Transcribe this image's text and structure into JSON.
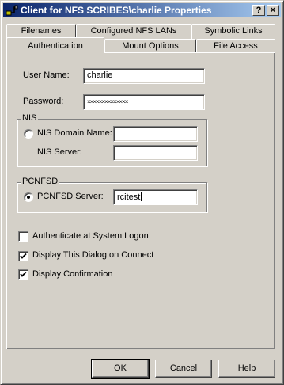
{
  "window": {
    "title": "Client for NFS SCRIBES\\charlie Properties",
    "help_button": "?",
    "close_button": "×"
  },
  "tabs": {
    "row_back": [
      "Filenames",
      "Configured NFS LANs",
      "Symbolic Links"
    ],
    "row_front": [
      "Authentication",
      "Mount Options",
      "File Access"
    ],
    "active": "Authentication"
  },
  "auth": {
    "user_name_label": "User Name:",
    "user_name_value": "charlie",
    "password_label": "Password:",
    "password_value": "××××××××××××××"
  },
  "nis": {
    "group_title": "NIS",
    "domain_label": "NIS Domain Name:",
    "domain_value": "",
    "server_label": "NIS Server:",
    "server_value": "",
    "selected": false
  },
  "pcnfsd": {
    "group_title": "PCNFSD",
    "server_label": "PCNFSD Server:",
    "server_value": "rcitest",
    "selected": true
  },
  "options": [
    {
      "label": "Authenticate at System Logon",
      "checked": false
    },
    {
      "label": "Display This Dialog on Connect",
      "checked": true
    },
    {
      "label": "Display Confirmation",
      "checked": true
    }
  ],
  "buttons": {
    "ok": "OK",
    "cancel": "Cancel",
    "help": "Help"
  }
}
